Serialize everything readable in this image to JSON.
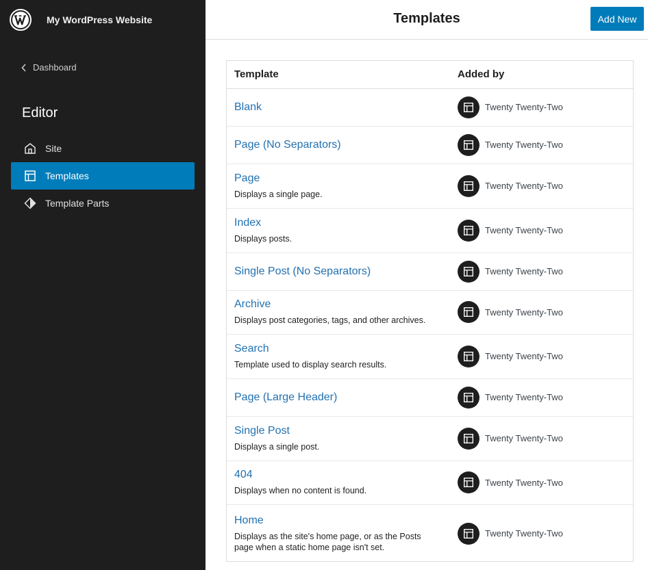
{
  "sidebar": {
    "site_name": "My WordPress Website",
    "back_label": "Dashboard",
    "heading": "Editor",
    "nav": [
      {
        "label": "Site",
        "icon": "home-icon",
        "active": false
      },
      {
        "label": "Templates",
        "icon": "layout-icon",
        "active": true
      },
      {
        "label": "Template Parts",
        "icon": "diamond-icon",
        "active": false
      }
    ]
  },
  "header": {
    "title": "Templates",
    "add_new": "Add New"
  },
  "table": {
    "columns": [
      "Template",
      "Added by"
    ],
    "rows": [
      {
        "title": "Blank",
        "desc": "",
        "added_by": "Twenty Twenty-Two"
      },
      {
        "title": "Page (No Separators)",
        "desc": "",
        "added_by": "Twenty Twenty-Two"
      },
      {
        "title": "Page",
        "desc": "Displays a single page.",
        "added_by": "Twenty Twenty-Two"
      },
      {
        "title": "Index",
        "desc": "Displays posts.",
        "added_by": "Twenty Twenty-Two"
      },
      {
        "title": "Single Post (No Separators)",
        "desc": "",
        "added_by": "Twenty Twenty-Two"
      },
      {
        "title": "Archive",
        "desc": "Displays post categories, tags, and other archives.",
        "added_by": "Twenty Twenty-Two"
      },
      {
        "title": "Search",
        "desc": "Template used to display search results.",
        "added_by": "Twenty Twenty-Two"
      },
      {
        "title": "Page (Large Header)",
        "desc": "",
        "added_by": "Twenty Twenty-Two"
      },
      {
        "title": "Single Post",
        "desc": "Displays a single post.",
        "added_by": "Twenty Twenty-Two"
      },
      {
        "title": "404",
        "desc": "Displays when no content is found.",
        "added_by": "Twenty Twenty-Two"
      },
      {
        "title": "Home",
        "desc": "Displays as the site's home page, or as the Posts page when a static home page isn't set.",
        "added_by": "Twenty Twenty-Two"
      }
    ]
  },
  "colors": {
    "sidebar_bg": "#1e1e1e",
    "accent": "#007cba",
    "link": "#2271b1"
  }
}
